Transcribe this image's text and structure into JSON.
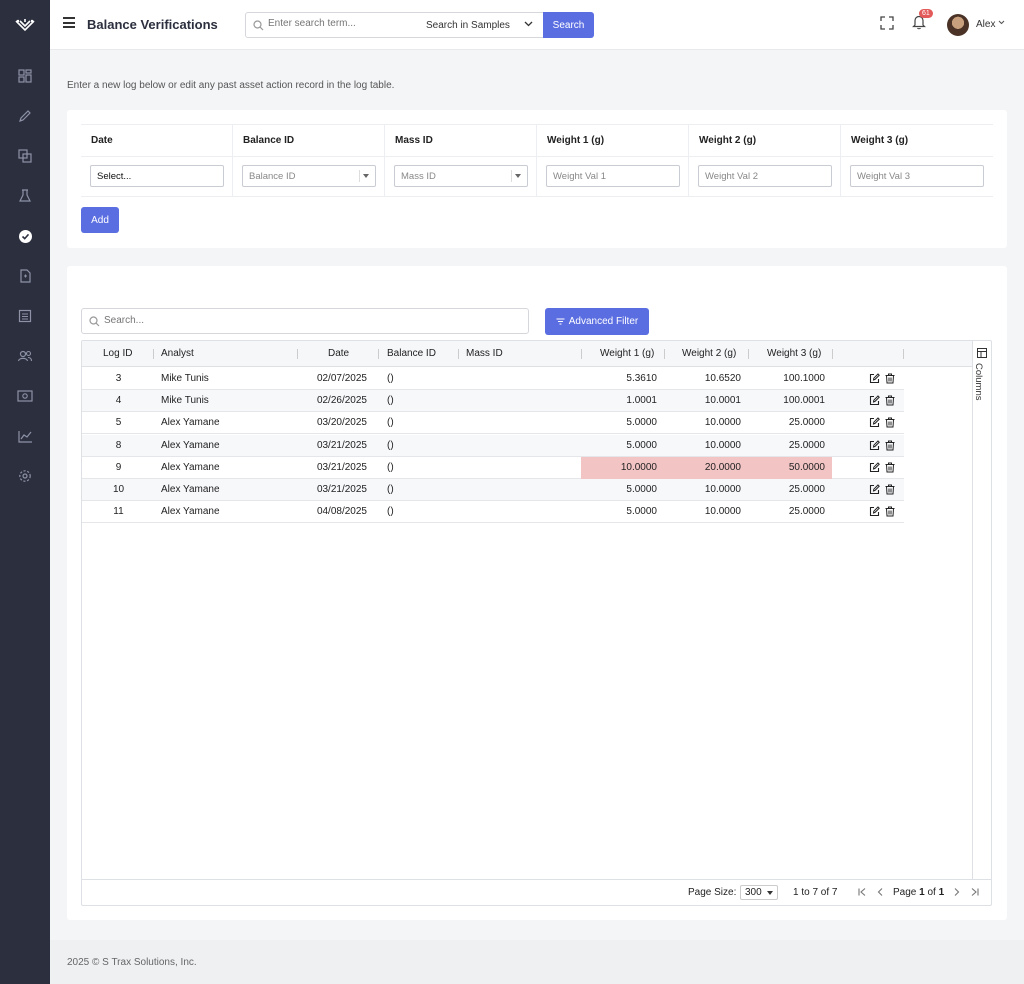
{
  "sidebar": {
    "items": [
      {
        "icon": "dashboard-icon",
        "active": false
      },
      {
        "icon": "pen-icon",
        "active": false
      },
      {
        "icon": "copy-icon",
        "active": false
      },
      {
        "icon": "flask-icon",
        "active": false
      },
      {
        "icon": "check-badge-icon",
        "active": true
      },
      {
        "icon": "file-icon",
        "active": false
      },
      {
        "icon": "list-icon",
        "active": false
      },
      {
        "icon": "users-icon",
        "active": false
      },
      {
        "icon": "money-icon",
        "active": false
      },
      {
        "icon": "chart-icon",
        "active": false
      },
      {
        "icon": "gear-icon",
        "active": false
      }
    ]
  },
  "header": {
    "title": "Balance Verifications",
    "search_placeholder": "Enter search term...",
    "search_scope": "Search in Samples",
    "search_button": "Search",
    "notification_count": "61",
    "user_name": "Alex"
  },
  "intro_text": "Enter a new log below or edit any past asset action record in the log table.",
  "entry_form": {
    "columns": [
      "Date",
      "Balance ID",
      "Mass ID",
      "Weight 1 (g)",
      "Weight 2 (g)",
      "Weight 3 (g)"
    ],
    "date_value": "Select...",
    "balance_placeholder": "Balance ID",
    "mass_placeholder": "Mass ID",
    "weight1_placeholder": "Weight Val 1",
    "weight2_placeholder": "Weight Val 2",
    "weight3_placeholder": "Weight Val 3",
    "add_button": "Add"
  },
  "grid": {
    "search_placeholder": "Search...",
    "advanced_filter": "Advanced Filter",
    "columns": [
      "Log ID",
      "Analyst",
      "Date",
      "Balance ID",
      "Mass ID",
      "Weight 1 (g)",
      "Weight 2 (g)",
      "Weight 3 (g)"
    ],
    "rows": [
      {
        "log_id": "3",
        "analyst": "Mike Tunis",
        "date": "02/07/2025",
        "balance_id": "()",
        "mass_id": "",
        "w1": "5.3610",
        "w2": "10.6520",
        "w3": "100.1000",
        "highlight": false
      },
      {
        "log_id": "4",
        "analyst": "Mike Tunis",
        "date": "02/26/2025",
        "balance_id": "()",
        "mass_id": "",
        "w1": "1.0001",
        "w2": "10.0001",
        "w3": "100.0001",
        "highlight": false
      },
      {
        "log_id": "5",
        "analyst": "Alex Yamane",
        "date": "03/20/2025",
        "balance_id": "()",
        "mass_id": "",
        "w1": "5.0000",
        "w2": "10.0000",
        "w3": "25.0000",
        "highlight": false
      },
      {
        "log_id": "8",
        "analyst": "Alex Yamane",
        "date": "03/21/2025",
        "balance_id": "()",
        "mass_id": "",
        "w1": "5.0000",
        "w2": "10.0000",
        "w3": "25.0000",
        "highlight": false
      },
      {
        "log_id": "9",
        "analyst": "Alex Yamane",
        "date": "03/21/2025",
        "balance_id": "()",
        "mass_id": "",
        "w1": "10.0000",
        "w2": "20.0000",
        "w3": "50.0000",
        "highlight": true
      },
      {
        "log_id": "10",
        "analyst": "Alex Yamane",
        "date": "03/21/2025",
        "balance_id": "()",
        "mass_id": "",
        "w1": "5.0000",
        "w2": "10.0000",
        "w3": "25.0000",
        "highlight": false
      },
      {
        "log_id": "11",
        "analyst": "Alex Yamane",
        "date": "04/08/2025",
        "balance_id": "()",
        "mass_id": "",
        "w1": "5.0000",
        "w2": "10.0000",
        "w3": "25.0000",
        "highlight": false
      }
    ],
    "columns_panel_label": "Columns",
    "footer": {
      "page_size_label": "Page Size:",
      "page_size": "300",
      "range_text": "1 to 7 of 7",
      "page_label": "Page",
      "current_page": "1",
      "of_label": "of",
      "total_pages": "1"
    }
  },
  "colors": {
    "accent": "#5b6ee1",
    "sidebar": "#2b2f3e",
    "highlight": "#f2c4c4"
  },
  "footer_text": "2025 © S Trax Solutions, Inc."
}
